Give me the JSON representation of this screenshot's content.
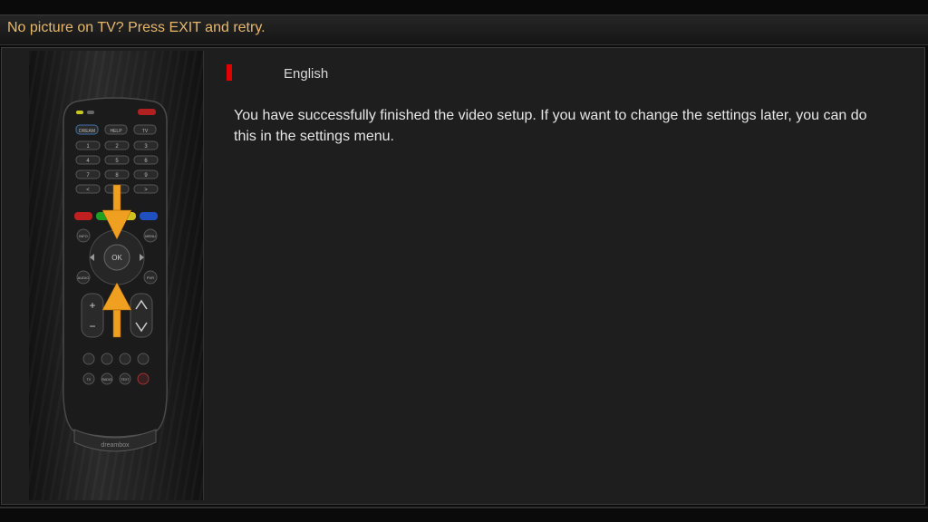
{
  "header": {
    "message": "No picture on TV? Press EXIT and retry."
  },
  "language": {
    "selected": "English",
    "marker_color": "#e00000"
  },
  "content": {
    "message": "You have successfully finished the video setup. If you want to change the settings later, you can do this in the settings menu."
  },
  "remote": {
    "brand": "dreambox",
    "buttons": {
      "dream": "DREAM",
      "help": "HELP",
      "tv": "TV",
      "info": "INFO",
      "menu": "MENU",
      "ok": "OK",
      "audio": "AUDIO",
      "pvr": "PVR",
      "digits": [
        "1",
        "2",
        "3",
        "4",
        "5",
        "6",
        "7",
        "8",
        "9",
        "<",
        "0",
        ">"
      ],
      "bottom_row": [
        "TV",
        "RADIO",
        "TEXT"
      ]
    },
    "arrows": [
      "down-arrow-icon",
      "up-arrow-icon"
    ]
  }
}
